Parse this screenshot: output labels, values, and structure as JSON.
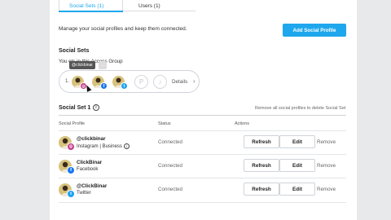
{
  "tabs": [
    {
      "label": "Social Sets (1)",
      "active": true
    },
    {
      "label": "Users (1)",
      "active": false
    }
  ],
  "header": {
    "description": "Manage your social profiles and keep them connected.",
    "add_button": "Add Social Profile"
  },
  "social_sets": {
    "title": "Social Sets",
    "you_line": "You         ets in this Access Group",
    "tooltip": "@clickbinar",
    "tooltip2": "...",
    "set_number": "1.",
    "details_label": "Details",
    "empty_slots": [
      "pinterest-icon",
      "tiktok-icon"
    ]
  },
  "social_set_1": {
    "title": "Social Set 1",
    "remove_hint": "Remove all social profiles to delete Social Set",
    "columns": [
      "Social Profile",
      "Status",
      "Actions"
    ],
    "rows": [
      {
        "name": "@clickbinar",
        "sub": "Instagram | Business",
        "status": "Connected",
        "network": "instagram",
        "badge_color": "#c13584",
        "badge": "◎"
      },
      {
        "name": "ClickBinar",
        "sub": "Facebook",
        "status": "Connected",
        "network": "facebook",
        "badge_color": "#1877f2",
        "badge": "f"
      },
      {
        "name": "@ClickBinar",
        "sub": "Twitter",
        "status": "Connected",
        "network": "twitter",
        "badge_color": "#1da1f2",
        "badge": "t"
      }
    ],
    "refresh_label": "Refresh",
    "edit_label": "Edit",
    "remove_label": "Remove"
  },
  "colors": {
    "accent": "#1ea7ec",
    "background": "#e8e9eb"
  }
}
